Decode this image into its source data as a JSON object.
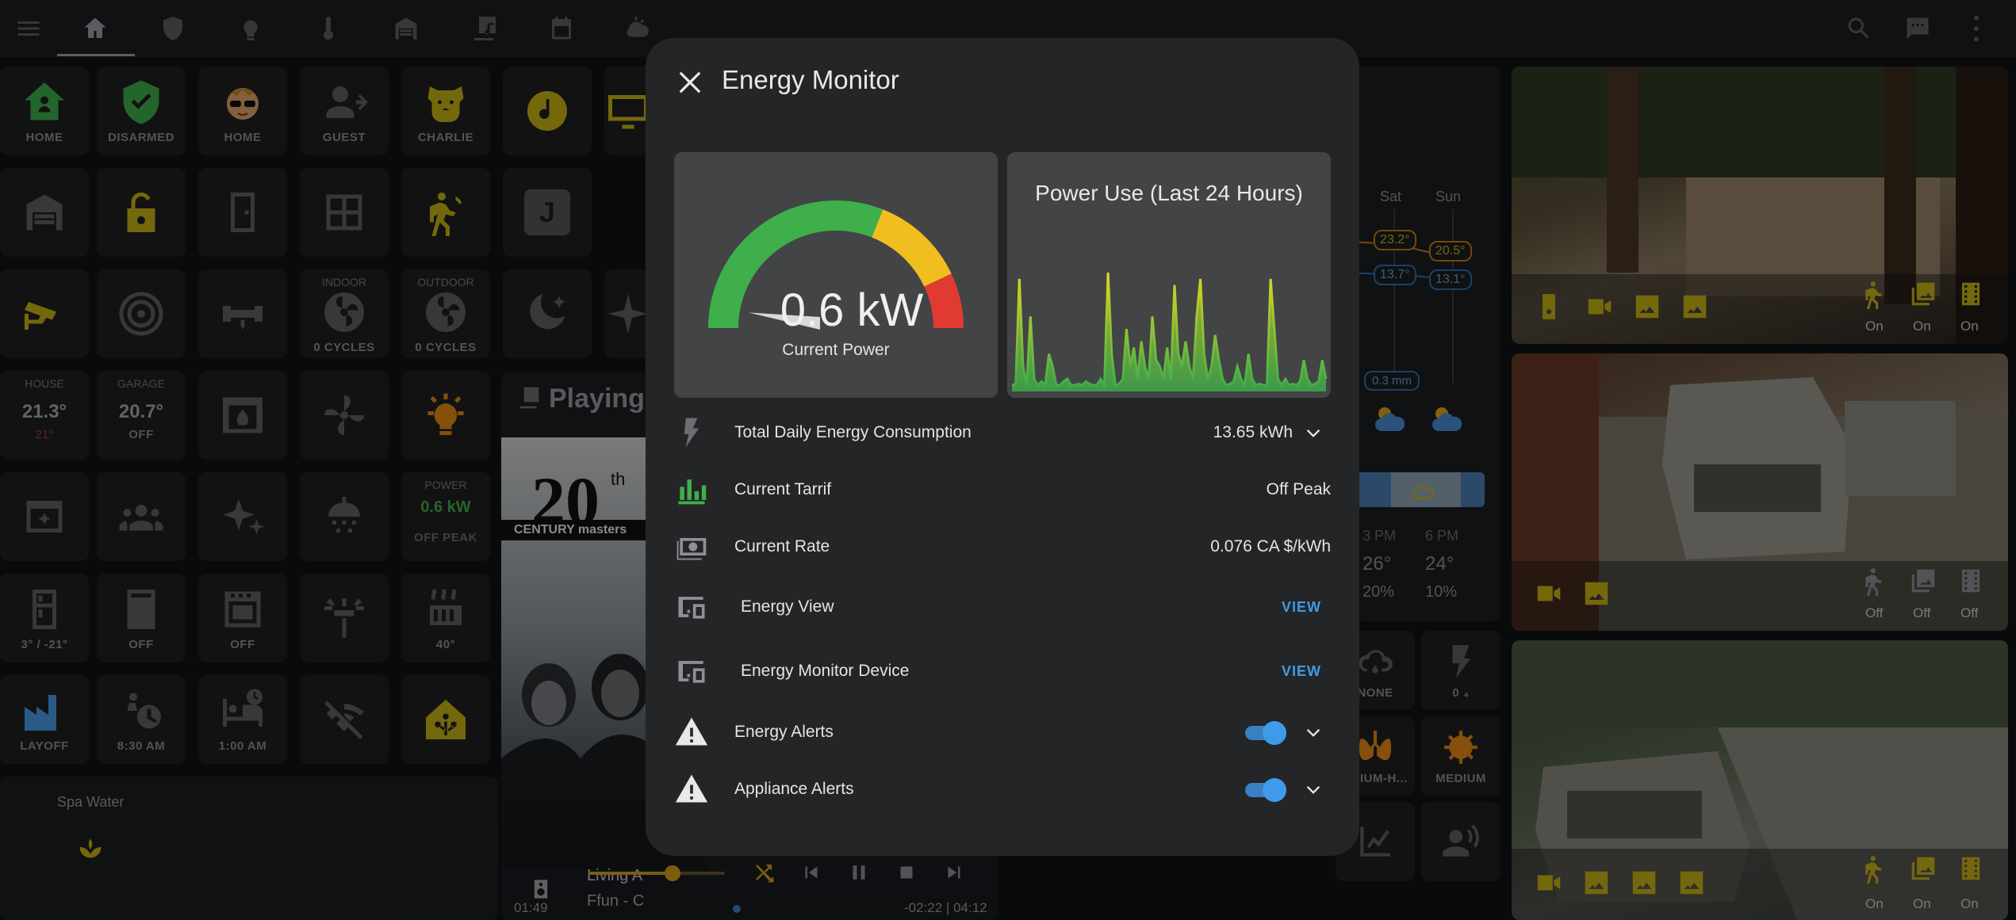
{
  "topbar": {
    "icons": [
      "menu-icon",
      "home-icon",
      "shield-icon",
      "lightbulb-icon",
      "thermometer-icon",
      "garage-icon",
      "music-library-icon",
      "calendar-icon",
      "weather-icon",
      "search-icon",
      "chat-icon",
      "more-vert-icon"
    ]
  },
  "tiles": {
    "home": "HOME",
    "disarmed": "DISARMED",
    "person_home": "HOME",
    "guest": "GUEST",
    "charlie": "CHARLIE",
    "indoor": "INDOOR",
    "outdoor": "OUTDOOR",
    "indoor_cycles": "0 CYCLES",
    "outdoor_cycles": "0 CYCLES",
    "house": "HOUSE",
    "house_temp": "21.3°",
    "house_target": "21°",
    "garage": "GARAGE",
    "garage_temp": "20.7°",
    "garage_state": "OFF",
    "power": "POWER",
    "power_value": "0.6 kW",
    "power_tariff": "OFF PEAK",
    "fridge": "3° / -21°",
    "washer": "OFF",
    "oven": "OFF",
    "heater": "40°",
    "layoff": "LAYOFF",
    "alarm1": "8:30 AM",
    "alarm2": "1:00 AM",
    "spa_water": "Spa Water",
    "j_letter": "J"
  },
  "media": {
    "header": "Playing",
    "album_top": "20",
    "album_th": "th",
    "album_sub": "CENTURY masters",
    "room": "Living A",
    "artist": "Ffun - C",
    "elapsed": "01:49",
    "remaining": "-02:22",
    "duration": "04:12"
  },
  "weather": {
    "days": [
      "Sat",
      "Sun"
    ],
    "highs": [
      "23.2°",
      "20.5°"
    ],
    "lows": [
      "13.7°",
      "13.1°"
    ],
    "rain": "0.3 mm",
    "hours": [
      "3 PM",
      "6 PM"
    ],
    "hour_temps": [
      "26°",
      "24°"
    ],
    "hour_pop": [
      "20%",
      "10%"
    ]
  },
  "sensors": {
    "none": "NONE",
    "lightning": "0 ₄",
    "pollen": "EDIUM-H...",
    "medium": "MEDIUM"
  },
  "cameras": {
    "labels1": [
      "On",
      "On",
      "On"
    ],
    "labels2": [
      "Off",
      "Off",
      "Off"
    ],
    "labels3": [
      "On",
      "On",
      "On"
    ]
  },
  "dialog": {
    "title": "Energy Monitor",
    "gauge_value": 0.6,
    "gauge_max": 2.0,
    "gauge_text": "0.6 kW",
    "gauge_label": "Current Power",
    "chart_title": "Power Use (Last 24 Hours)",
    "chart_series": [
      0.05,
      0.06,
      0.9,
      0.2,
      0.05,
      0.6,
      0.1,
      0.05,
      0.08,
      0.05,
      0.3,
      0.2,
      0.05,
      0.05,
      0.08,
      0.1,
      0.05,
      0.05,
      0.06,
      0.05,
      0.08,
      0.06,
      0.05,
      0.05,
      0.1,
      0.05,
      0.95,
      0.3,
      0.05,
      0.06,
      0.1,
      0.5,
      0.2,
      0.35,
      0.1,
      0.4,
      0.2,
      0.1,
      0.6,
      0.25,
      0.2,
      0.1,
      0.35,
      0.1,
      0.85,
      0.3,
      0.2,
      0.4,
      0.2,
      0.1,
      0.6,
      0.9,
      0.3,
      0.1,
      0.2,
      0.45,
      0.25,
      0.1,
      0.05,
      0.06,
      0.08,
      0.2,
      0.1,
      0.05,
      0.3,
      0.1,
      0.05,
      0.06,
      0.05,
      0.05,
      0.9,
      0.5,
      0.1,
      0.05,
      0.1,
      0.05,
      0.06,
      0.05,
      0.08,
      0.25,
      0.1,
      0.05,
      0.06,
      0.08,
      0.25,
      0.1
    ],
    "rows": [
      {
        "label": "Total Daily Energy Consumption",
        "value": "13.65 kWh"
      },
      {
        "label": "Current Tarrif",
        "value": "Off Peak"
      },
      {
        "label": "Current Rate",
        "value": "0.076 CA $/kWh"
      },
      {
        "label": "Energy View",
        "value": "VIEW"
      },
      {
        "label": "Energy Monitor Device",
        "value": "VIEW"
      },
      {
        "label": "Energy Alerts",
        "value": ""
      },
      {
        "label": "Appliance Alerts",
        "value": ""
      }
    ]
  }
}
